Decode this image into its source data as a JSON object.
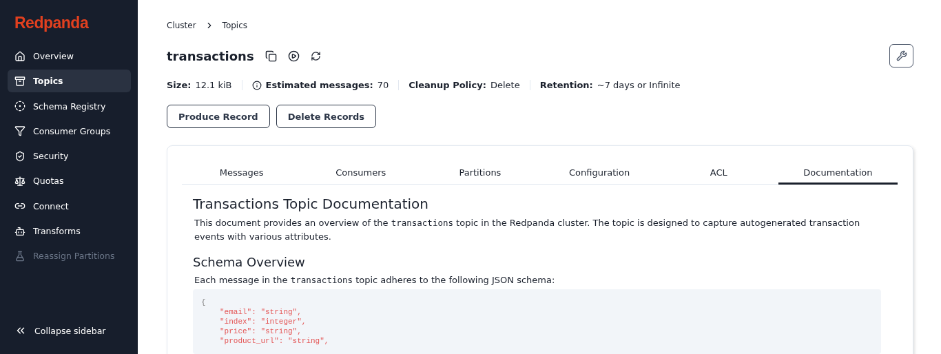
{
  "sidebar": {
    "logo": "Redpanda",
    "items": [
      {
        "kind": "home",
        "label": "Overview",
        "selected": false,
        "disabled": false
      },
      {
        "kind": "topics",
        "label": "Topics",
        "selected": true,
        "disabled": false
      },
      {
        "kind": "schema",
        "label": "Schema Registry",
        "selected": false,
        "disabled": false
      },
      {
        "kind": "groups",
        "label": "Consumer Groups",
        "selected": false,
        "disabled": false
      },
      {
        "kind": "security",
        "label": "Security",
        "selected": false,
        "disabled": false
      },
      {
        "kind": "quotas",
        "label": "Quotas",
        "selected": false,
        "disabled": false
      },
      {
        "kind": "connect",
        "label": "Connect",
        "selected": false,
        "disabled": false
      },
      {
        "kind": "transforms",
        "label": "Transforms",
        "selected": false,
        "disabled": false
      },
      {
        "kind": "reassign",
        "label": "Reassign Partitions",
        "selected": false,
        "disabled": true
      }
    ],
    "collapse": "Collapse sidebar"
  },
  "breadcrumb": [
    "Cluster",
    "Topics"
  ],
  "title": "transactions",
  "stats": [
    {
      "label": "Size:",
      "value": "12.1 kiB",
      "info": false
    },
    {
      "label": "Estimated messages:",
      "value": "70",
      "info": true
    },
    {
      "label": "Cleanup Policy:",
      "value": "Delete",
      "info": false
    },
    {
      "label": "Retention:",
      "value": "~7 days or Infinite",
      "info": false
    }
  ],
  "buttons": [
    "Produce Record",
    "Delete Records"
  ],
  "tabs": [
    {
      "label": "Messages",
      "selected": false
    },
    {
      "label": "Consumers",
      "selected": false
    },
    {
      "label": "Partitions",
      "selected": false
    },
    {
      "label": "Configuration",
      "selected": false
    },
    {
      "label": "ACL",
      "selected": false
    },
    {
      "label": "Documentation",
      "selected": true
    }
  ],
  "doc": {
    "heading": "Transactions Topic Documentation",
    "intro": [
      {
        "kind": "text",
        "text": "This document provides an overview of the "
      },
      {
        "kind": "code",
        "text": "transactions"
      },
      {
        "kind": "text",
        "text": " topic in the Redpanda cluster. The topic is designed to capture autogenerated transaction events with various attributes."
      }
    ],
    "subheading": "Schema Overview",
    "schema_intro": [
      {
        "kind": "text",
        "text": "Each message in the "
      },
      {
        "kind": "code",
        "text": "transactions"
      },
      {
        "kind": "text",
        "text": " topic adheres to the following JSON schema:"
      }
    ],
    "code": [
      {
        "kind": "punct",
        "text": "{"
      },
      {
        "kind": "entry",
        "text": "\"email\": \"string\","
      },
      {
        "kind": "entry",
        "text": "\"index\": \"integer\","
      },
      {
        "kind": "entry",
        "text": "\"price\": \"string\","
      },
      {
        "kind": "entry",
        "text": "\"product_url\": \"string\","
      }
    ]
  }
}
